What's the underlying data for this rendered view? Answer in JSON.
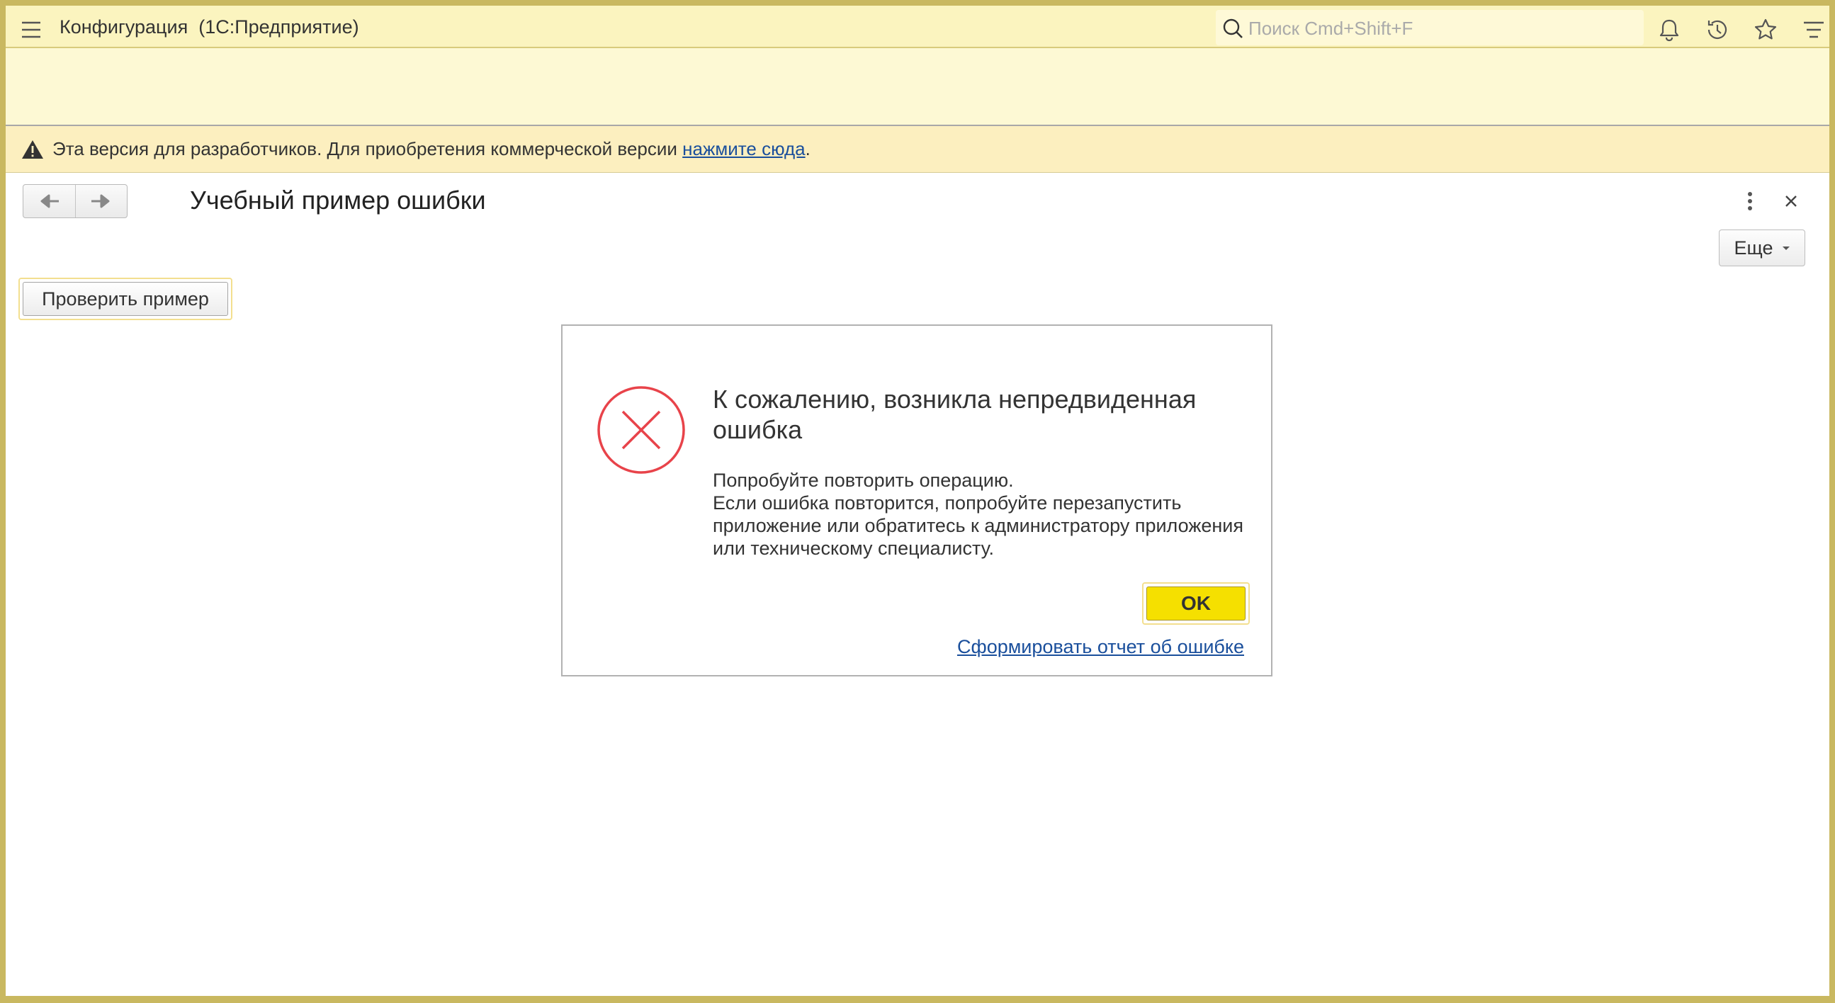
{
  "app": {
    "title": "Конфигурация  (1С:Предприятие)",
    "search_placeholder": "Поиск Cmd+Shift+F"
  },
  "topbar_icons": [
    "menu-icon",
    "bell-icon",
    "history-icon",
    "star-icon",
    "filter-menu-icon"
  ],
  "notice": {
    "text": "Эта версия для разработчиков. Для приобретения коммерческой версии ",
    "link": "нажмите сюда",
    "suffix": "."
  },
  "form": {
    "title": "Учебный пример ошибки",
    "more_label": "Еще",
    "check_button": "Проверить пример"
  },
  "dialog": {
    "title": "К сожалению, возникла непредвиденная ошибка",
    "body_lines": [
      "Попробуйте повторить операцию.",
      "Если ошибка повторится, попробуйте перезапустить",
      "приложение или обратитесь к администратору приложения",
      "или техническому специалисту."
    ],
    "ok_label": "OK",
    "report_link": "Сформировать отчет об ошибке"
  },
  "colors": {
    "frame": "#c9b860",
    "topbar": "#fbf4bf",
    "ok_button": "#f5e000",
    "error_red": "#e8434a",
    "link": "#1a4f9c"
  }
}
